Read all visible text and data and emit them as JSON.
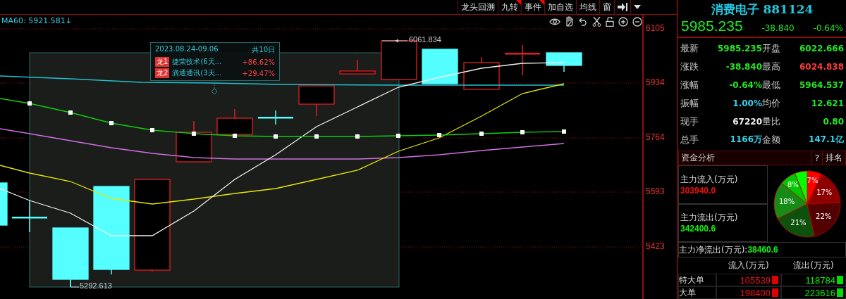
{
  "toolbar": {
    "tabs": [
      {
        "label": "龙头回溯",
        "flagged": false
      },
      {
        "label": "九转",
        "flagged": true
      },
      {
        "label": "事件",
        "flagged": true
      },
      {
        "label": "加自选",
        "flagged": false
      },
      {
        "label": "均线",
        "flagged": false
      },
      {
        "label": "窗",
        "flagged": false
      }
    ]
  },
  "chart": {
    "ma_label": "MA60: 5921.581↓",
    "price_axis": [
      "6105",
      "5934",
      "5764",
      "5593",
      "5423"
    ],
    "high_label": "6061.834",
    "low_label": "5292.613",
    "tooltip": {
      "range": "2023.08.24-09.06",
      "days": "共10日",
      "leaders": [
        {
          "badge": "龙1",
          "name": "捷荣技术(6天...",
          "change": "+86.62%"
        },
        {
          "badge": "龙2",
          "name": "滴通通讯(3天...",
          "change": "+29.47%"
        }
      ]
    }
  },
  "quote": {
    "name": "消费电子",
    "code": "881124",
    "price": "5985.235",
    "change": "-38.840",
    "change_pct": "-0.64%",
    "stats": [
      {
        "label": "最新",
        "value": "5985.235",
        "color": "#22e822"
      },
      {
        "label": "开盘",
        "value": "6022.666",
        "color": "#22e822"
      },
      {
        "label": "涨跌",
        "value": "-38.840",
        "color": "#22e822"
      },
      {
        "label": "最高",
        "value": "6024.838",
        "color": "#ff3b3b"
      },
      {
        "label": "涨幅",
        "value": "-0.64%",
        "color": "#22e822"
      },
      {
        "label": "最低",
        "value": "5964.537",
        "color": "#22e822"
      },
      {
        "label": "振幅",
        "value": "1.00%",
        "color": "#33d6f0"
      },
      {
        "label": "均价",
        "value": "12.621",
        "color": "#22e822"
      },
      {
        "label": "现手",
        "value": "67220",
        "color": "#f0f0f0"
      },
      {
        "label": "量比",
        "value": "0.80",
        "color": "#22e822"
      },
      {
        "label": "总手",
        "value": "1166万",
        "color": "#33d6f0"
      },
      {
        "label": "金额",
        "value": "147.1亿",
        "color": "#33d6f0"
      }
    ]
  },
  "fund_analysis": {
    "title": "资金分析",
    "help": "?",
    "rank": "排名",
    "inflow": {
      "label": "主力流入(万元)",
      "value": "303940.0"
    },
    "outflow": {
      "label": "主力流出(万元)",
      "value": "342400.6"
    },
    "net": {
      "label": "主力净流出(万元):",
      "value": "38460.6"
    },
    "chart_data": {
      "type": "pie",
      "values": [
        7,
        17,
        22,
        21,
        18,
        8,
        6
      ],
      "value_labels": [
        "7%",
        "17%",
        "22%",
        "21%",
        "18%",
        "8%",
        null
      ],
      "colors": [
        "#ff0000",
        "#8c0000",
        "#520000",
        "#0c520c",
        "#168c16",
        "#00c800",
        "#00ff00"
      ]
    },
    "columns": [
      "流入(万元)",
      "流出(万元)"
    ],
    "rows": [
      {
        "label": "特大单",
        "inflow": "105539",
        "outflow": "118784"
      },
      {
        "label": "大单",
        "inflow": "198400",
        "outflow": "223616"
      }
    ]
  }
}
